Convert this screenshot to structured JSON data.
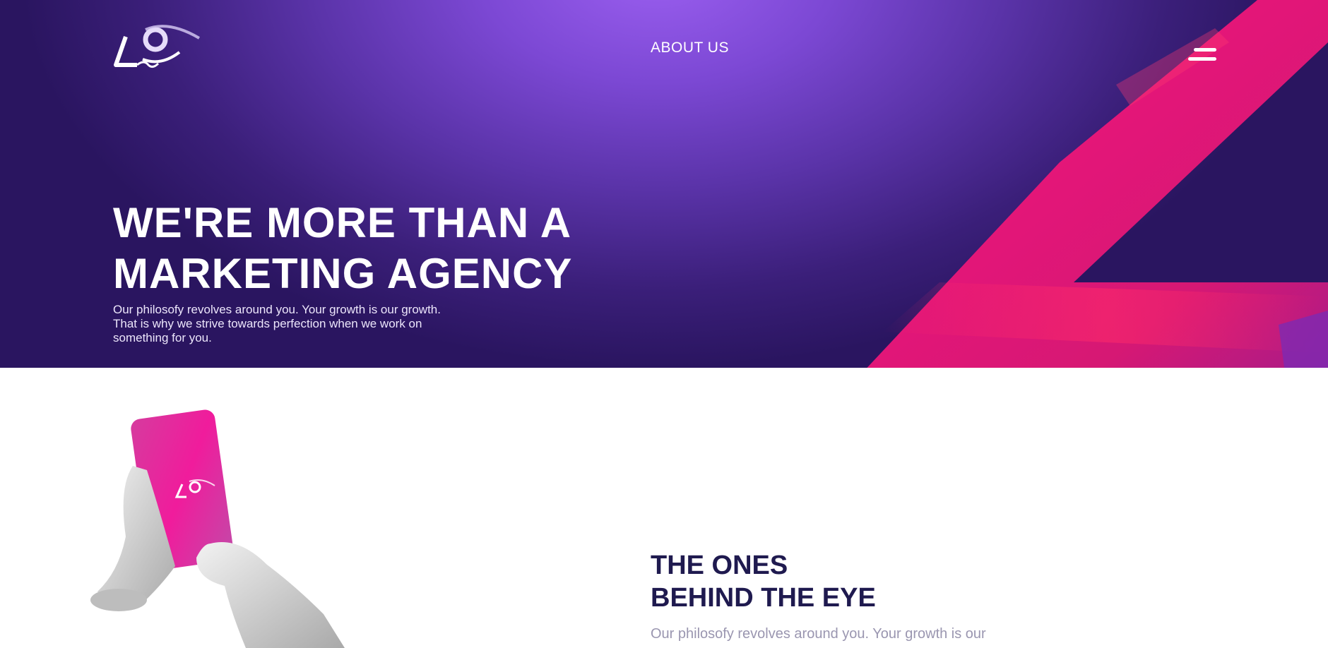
{
  "header": {
    "nav_about": "ABOUT US",
    "logo_icon": "eye-logo-icon",
    "menu_icon": "hamburger-menu-icon"
  },
  "hero": {
    "title_line1": "WE'RE MORE THAN A",
    "title_line2": "MARKETING AGENCY",
    "subtitle_line1": "Our philosofy revolves around you. Your growth is our growth.",
    "subtitle_line2": "That is why we strive towards perfection when we work on",
    "subtitle_line3": "something for you."
  },
  "about": {
    "title_line1": "THE ONES",
    "title_line2": "BEHIND THE EYE",
    "text": "Our philosofy revolves around you. Your growth is our"
  },
  "colors": {
    "hero_purple": "#5a33a8",
    "accent_pink": "#e8157a",
    "heading_navy": "#1f1a4f",
    "muted_text": "#9a96b0"
  }
}
